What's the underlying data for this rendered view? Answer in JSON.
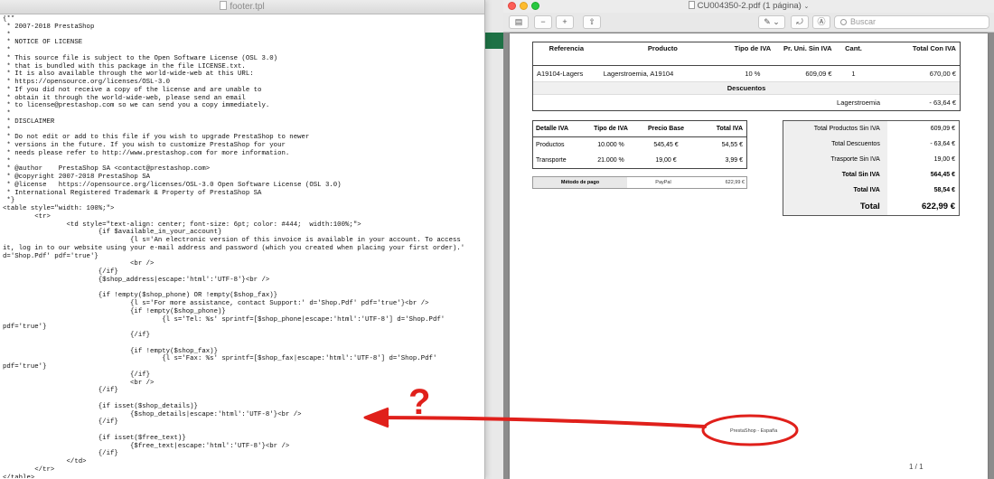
{
  "editor": {
    "title": "footer.tpl",
    "lines": [
      "{**",
      " * 2007-2018 PrestaShop",
      " *",
      " * NOTICE OF LICENSE",
      " *",
      " * This source file is subject to the Open Software License (OSL 3.0)",
      " * that is bundled with this package in the file LICENSE.txt.",
      " * It is also available through the world-wide-web at this URL:",
      " * https://opensource.org/licenses/OSL-3.0",
      " * If you did not receive a copy of the license and are unable to",
      " * obtain it through the world-wide-web, please send an email",
      " * to license@prestashop.com so we can send you a copy immediately.",
      " *",
      " * DISCLAIMER",
      " *",
      " * Do not edit or add to this file if you wish to upgrade PrestaShop to newer",
      " * versions in the future. If you wish to customize PrestaShop for your",
      " * needs please refer to http://www.prestashop.com for more information.",
      " *",
      " * @author    PrestaShop SA <contact@prestashop.com>",
      " * @copyright 2007-2018 PrestaShop SA",
      " * @license   https://opensource.org/licenses/OSL-3.0 Open Software License (OSL 3.0)",
      " * International Registered Trademark & Property of PrestaShop SA",
      " *}",
      "<table style=\"width: 100%;\">",
      "        <tr>",
      "                <td style=\"text-align: center; font-size: 6pt; color: #444;  width:100%;\">",
      "                        {if $available_in_your_account}",
      "                                {l s='An electronic version of this invoice is available in your account. To access",
      "it, log in to our website using your e-mail address and password (which you created when placing your first order).'",
      "d='Shop.Pdf' pdf='true'}",
      "                                <br />",
      "                        {/if}",
      "                        {$shop_address|escape:'html':'UTF-8'}<br />",
      "",
      "                        {if !empty($shop_phone) OR !empty($shop_fax)}",
      "                                {l s='For more assistance, contact Support:' d='Shop.Pdf' pdf='true'}<br />",
      "                                {if !empty($shop_phone)}",
      "                                        {l s='Tel: %s' sprintf=[$shop_phone|escape:'html':'UTF-8'] d='Shop.Pdf'",
      "pdf='true'}",
      "                                {/if}",
      "",
      "                                {if !empty($shop_fax)}",
      "                                        {l s='Fax: %s' sprintf=[$shop_fax|escape:'html':'UTF-8'] d='Shop.Pdf'",
      "pdf='true'}",
      "                                {/if}",
      "                                <br />",
      "                        {/if}",
      "",
      "                        {if isset($shop_details)}",
      "                                {$shop_details|escape:'html':'UTF-8'}<br />",
      "                        {/if}",
      "",
      "                        {if isset($free_text)}",
      "                                {$free_text|escape:'html':'UTF-8'}<br />",
      "                        {/if}",
      "                </td>",
      "        </tr>",
      "</table>"
    ]
  },
  "viewer": {
    "title": "CU004350-2.pdf (1 página)",
    "search_placeholder": "Buscar",
    "page_indicator": "1 / 1",
    "footer_text": "PrestaShop - España"
  },
  "invoice": {
    "headers": [
      "Referencia",
      "Producto",
      "Tipo de IVA",
      "Pr. Uni. Sin IVA",
      "Cant.",
      "Total Con IVA"
    ],
    "rows": [
      [
        "A19104-Lagers",
        "Lagerstroemia, A19104",
        "10 %",
        "609,09 €",
        "1",
        "670,00 €"
      ]
    ],
    "discounts_title": "Descuentos",
    "discount_name": "Lagerstroemia",
    "discount_value": "- 63,64 €"
  },
  "tax_detail": {
    "headers": [
      "Detalle IVA",
      "Tipo de IVA",
      "Precio Base",
      "Total IVA"
    ],
    "rows": [
      [
        "Productos",
        "10.000 %",
        "545,45 €",
        "54,55 €"
      ],
      [
        "Transporte",
        "21.000 %",
        "19,00 €",
        "3,99 €"
      ]
    ]
  },
  "payment": {
    "label": "Método de pago",
    "method": "PayPal",
    "amount": "622,99 €"
  },
  "totals": [
    {
      "label": "Total Productos Sin IVA",
      "value": "609,09 €"
    },
    {
      "label": "Total Descuentos",
      "value": "- 63,64 €"
    },
    {
      "label": "Trasporte Sin IVA",
      "value": "19,00 €"
    },
    {
      "label": "Total Sin IVA",
      "value": "564,45 €"
    },
    {
      "label": "Total IVA",
      "value": "58,54 €"
    },
    {
      "label": "Total",
      "value": "622,99 €"
    }
  ],
  "annotation": {
    "mark": "?"
  },
  "colors": {
    "annotation_red": "#e0201b"
  }
}
